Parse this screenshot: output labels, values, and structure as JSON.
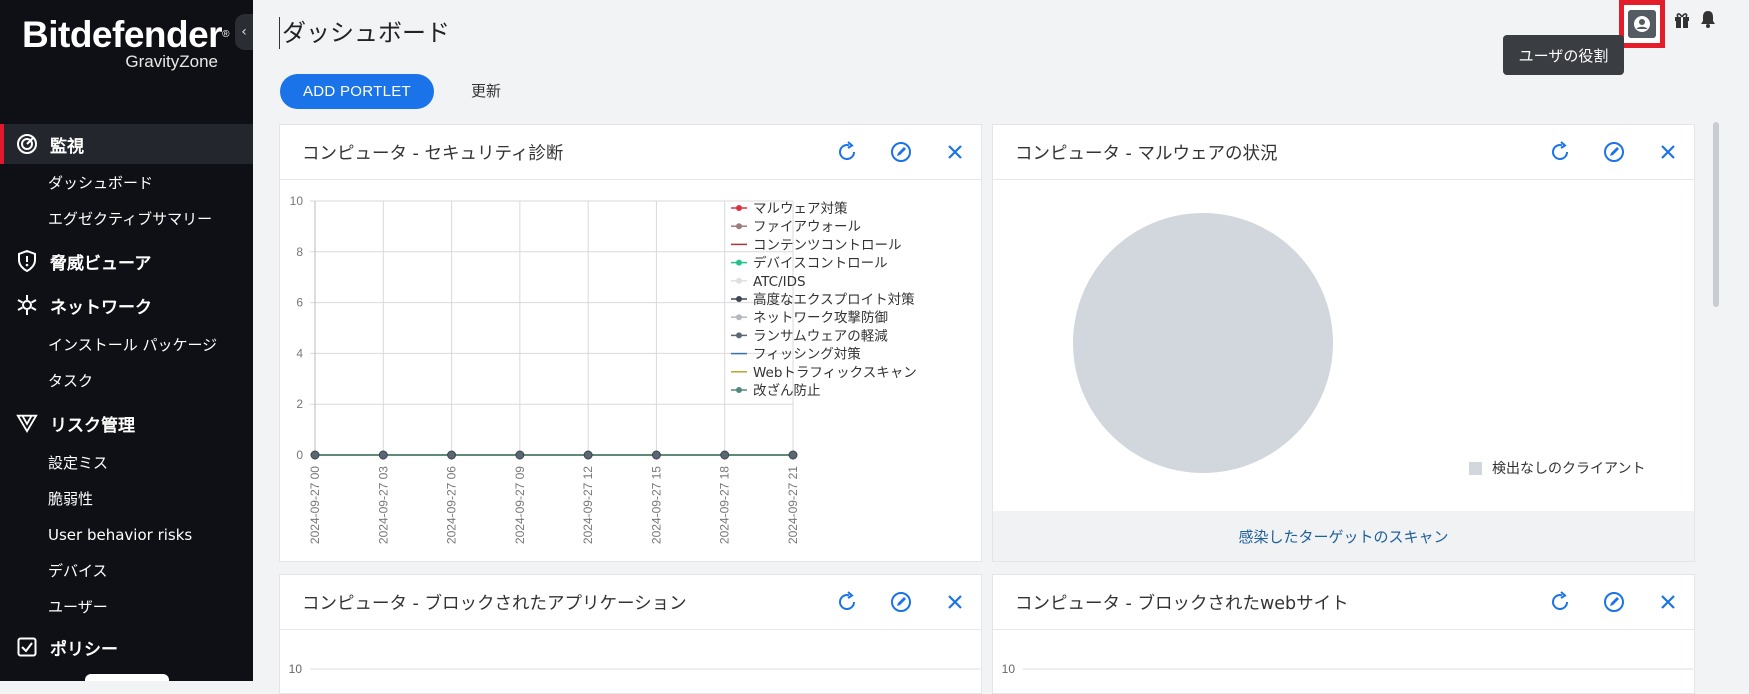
{
  "app": {
    "brand": "Bitdefender",
    "brand_mark": "®",
    "product": "GravityZone"
  },
  "sidebar": {
    "collapse_icon": "chevron-left",
    "sections": [
      {
        "label": "監視",
        "icon": "radar-icon",
        "active": true
      },
      {
        "label": "脅威ビューア",
        "icon": "shield-icon"
      },
      {
        "label": "ネットワーク",
        "icon": "network-icon"
      },
      {
        "label": "リスク管理",
        "icon": "risk-icon"
      },
      {
        "label": "ポリシー",
        "icon": "policy-icon"
      }
    ],
    "items": [
      "ダッシュボード",
      "エグゼクティブサマリー",
      "インストール パッケージ",
      "タスク",
      "設定ミス",
      "脆弱性",
      "User behavior risks",
      "デバイス",
      "ユーザー"
    ]
  },
  "header": {
    "title": "ダッシュボード",
    "add_portlet": "ADD PORTLET",
    "refresh": "更新",
    "tooltip": "ユーザの役割",
    "icons": [
      "user-role-icon",
      "gift-icon",
      "bell-icon"
    ]
  },
  "portlets": [
    {
      "title": "コンピュータ - セキュリティ診断"
    },
    {
      "title": "コンピュータ - マルウェアの状況",
      "footer_link": "感染したターゲットのスキャン"
    },
    {
      "title": "コンピュータ - ブロックされたアプリケーション"
    },
    {
      "title": "コンピュータ - ブロックされたwebサイト"
    }
  ],
  "chart_data": [
    {
      "type": "line",
      "x": [
        "2024-09-27 00",
        "2024-09-27 03",
        "2024-09-27 06",
        "2024-09-27 09",
        "2024-09-27 12",
        "2024-09-27 15",
        "2024-09-27 18",
        "2024-09-27 21"
      ],
      "ylim": [
        0,
        10
      ],
      "yticks": [
        0,
        2,
        4,
        6,
        8,
        10
      ],
      "grid": true,
      "legend_position": "right",
      "series": [
        {
          "name": "マルウェア対策",
          "color": "#d9323f",
          "values": [
            0,
            0,
            0,
            0,
            0,
            0,
            0,
            0
          ]
        },
        {
          "name": "ファイアウォール",
          "color": "#9e7b80",
          "values": [
            0,
            0,
            0,
            0,
            0,
            0,
            0,
            0
          ]
        },
        {
          "name": "コンテンツコントロール",
          "color": "#a13a3a",
          "values": [
            0,
            0,
            0,
            0,
            0,
            0,
            0,
            0
          ]
        },
        {
          "name": "デバイスコントロール",
          "color": "#22c38e",
          "values": [
            0,
            0,
            0,
            0,
            0,
            0,
            0,
            0
          ]
        },
        {
          "name": "ATC/IDS",
          "color": "#e0e0e0",
          "values": [
            0,
            0,
            0,
            0,
            0,
            0,
            0,
            0
          ]
        },
        {
          "name": "高度なエクスプロイト対策",
          "color": "#3c4752",
          "values": [
            0,
            0,
            0,
            0,
            0,
            0,
            0,
            0
          ]
        },
        {
          "name": "ネットワーク攻撃防御",
          "color": "#b5b9bd",
          "values": [
            0,
            0,
            0,
            0,
            0,
            0,
            0,
            0
          ]
        },
        {
          "name": "ランサムウェアの軽減",
          "color": "#5b6776",
          "values": [
            0,
            0,
            0,
            0,
            0,
            0,
            0,
            0
          ]
        },
        {
          "name": "フィッシング対策",
          "color": "#3b6fb0",
          "values": [
            0,
            0,
            0,
            0,
            0,
            0,
            0,
            0
          ]
        },
        {
          "name": "Webトラフィックスキャン",
          "color": "#b7a62a",
          "values": [
            0,
            0,
            0,
            0,
            0,
            0,
            0,
            0
          ]
        },
        {
          "name": "改ざん防止",
          "color": "#4f8a7c",
          "values": [
            0,
            0,
            0,
            0,
            0,
            0,
            0,
            0
          ]
        }
      ]
    },
    {
      "type": "pie",
      "slices": [
        {
          "label": "検出なしのクライアント",
          "value": 100,
          "color": "#d1d7dc"
        }
      ]
    },
    {
      "type": "line",
      "yticks": [
        10
      ]
    },
    {
      "type": "line",
      "yticks": [
        10
      ]
    }
  ]
}
